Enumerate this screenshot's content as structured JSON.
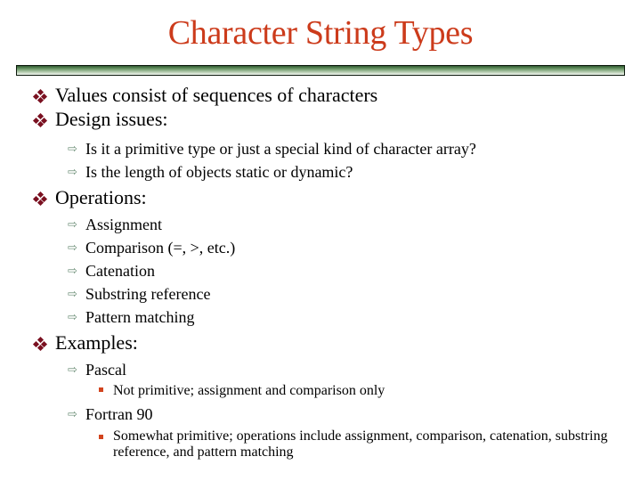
{
  "slide": {
    "title": "Character String Types",
    "colors": {
      "title": "#cc3b1b",
      "bullet_level1": "#7a1020",
      "bullet_level2": "#6d8f78",
      "bullet_level3": "#d2441e",
      "title_bar": "#2f5a2f"
    },
    "icons": {
      "level1": "four-diamond-bullet-icon",
      "level2": "outlined-right-arrow-icon",
      "level3": "small-square-bullet-icon"
    },
    "bullets": [
      {
        "text": "Values consist of sequences of characters"
      },
      {
        "text": "Design issues:",
        "children": [
          {
            "text": "Is it a primitive type or just a special kind of character array?"
          },
          {
            "text": "Is the length of objects static or dynamic?"
          }
        ]
      },
      {
        "text": "Operations:",
        "children": [
          {
            "text": "Assignment"
          },
          {
            "text": "Comparison (=, >, etc.)"
          },
          {
            "text": "Catenation"
          },
          {
            "text": "Substring reference"
          },
          {
            "text": "Pattern matching"
          }
        ]
      },
      {
        "text": "Examples:",
        "children": [
          {
            "text": "Pascal",
            "children": [
              {
                "text": "Not primitive; assignment and comparison only"
              }
            ]
          },
          {
            "text": "Fortran 90",
            "children": [
              {
                "text": "Somewhat primitive; operations include assignment, comparison, catenation, substring reference, and pattern matching"
              }
            ]
          }
        ]
      }
    ]
  }
}
